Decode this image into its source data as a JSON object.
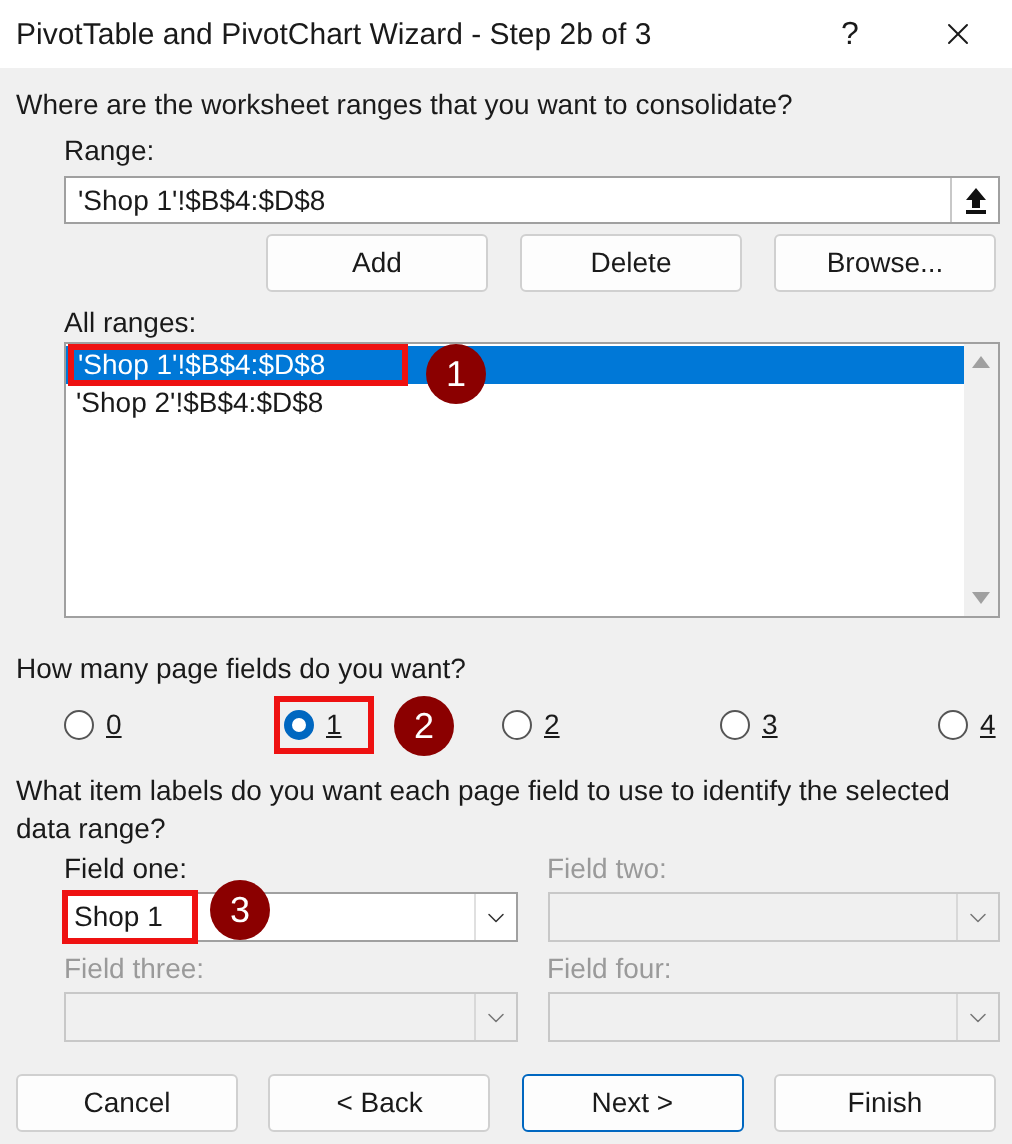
{
  "window": {
    "title": "PivotTable and PivotChart Wizard - Step 2b of 3",
    "help": "?"
  },
  "prompt": "Where are the worksheet ranges that you want to consolidate?",
  "range": {
    "label": "Range:",
    "value": "'Shop 1'!$B$4:$D$8"
  },
  "range_buttons": [
    "Add",
    "Delete",
    "Browse..."
  ],
  "all_ranges": {
    "label": "All ranges:",
    "items": [
      {
        "text": "'Shop 1'!$B$4:$D$8",
        "selected": true
      },
      {
        "text": "'Shop 2'!$B$4:$D$8",
        "selected": false
      }
    ]
  },
  "page_fields": {
    "question": "How many page fields do you want?",
    "options": [
      {
        "label": "0",
        "selected": false
      },
      {
        "label": "1",
        "selected": true
      },
      {
        "label": "2",
        "selected": false
      },
      {
        "label": "3",
        "selected": false
      },
      {
        "label": "4",
        "selected": false
      }
    ]
  },
  "item_labels": {
    "question": "What item labels do you want each page field to use to identify the selected data range?",
    "fields": [
      {
        "label": "Field one:",
        "value": "Shop 1",
        "disabled": false
      },
      {
        "label": "Field two:",
        "disabled": true
      },
      {
        "label": "Field three:",
        "disabled": true
      },
      {
        "label": "Field four:",
        "disabled": true
      }
    ]
  },
  "buttons": [
    {
      "label": "Cancel",
      "default": false
    },
    {
      "label": "< Back",
      "default": false
    },
    {
      "label": "Next >",
      "default": true
    },
    {
      "label": "Finish",
      "default": false
    }
  ],
  "annotations": [
    {
      "label": "1"
    },
    {
      "label": "2"
    },
    {
      "label": "3"
    }
  ]
}
